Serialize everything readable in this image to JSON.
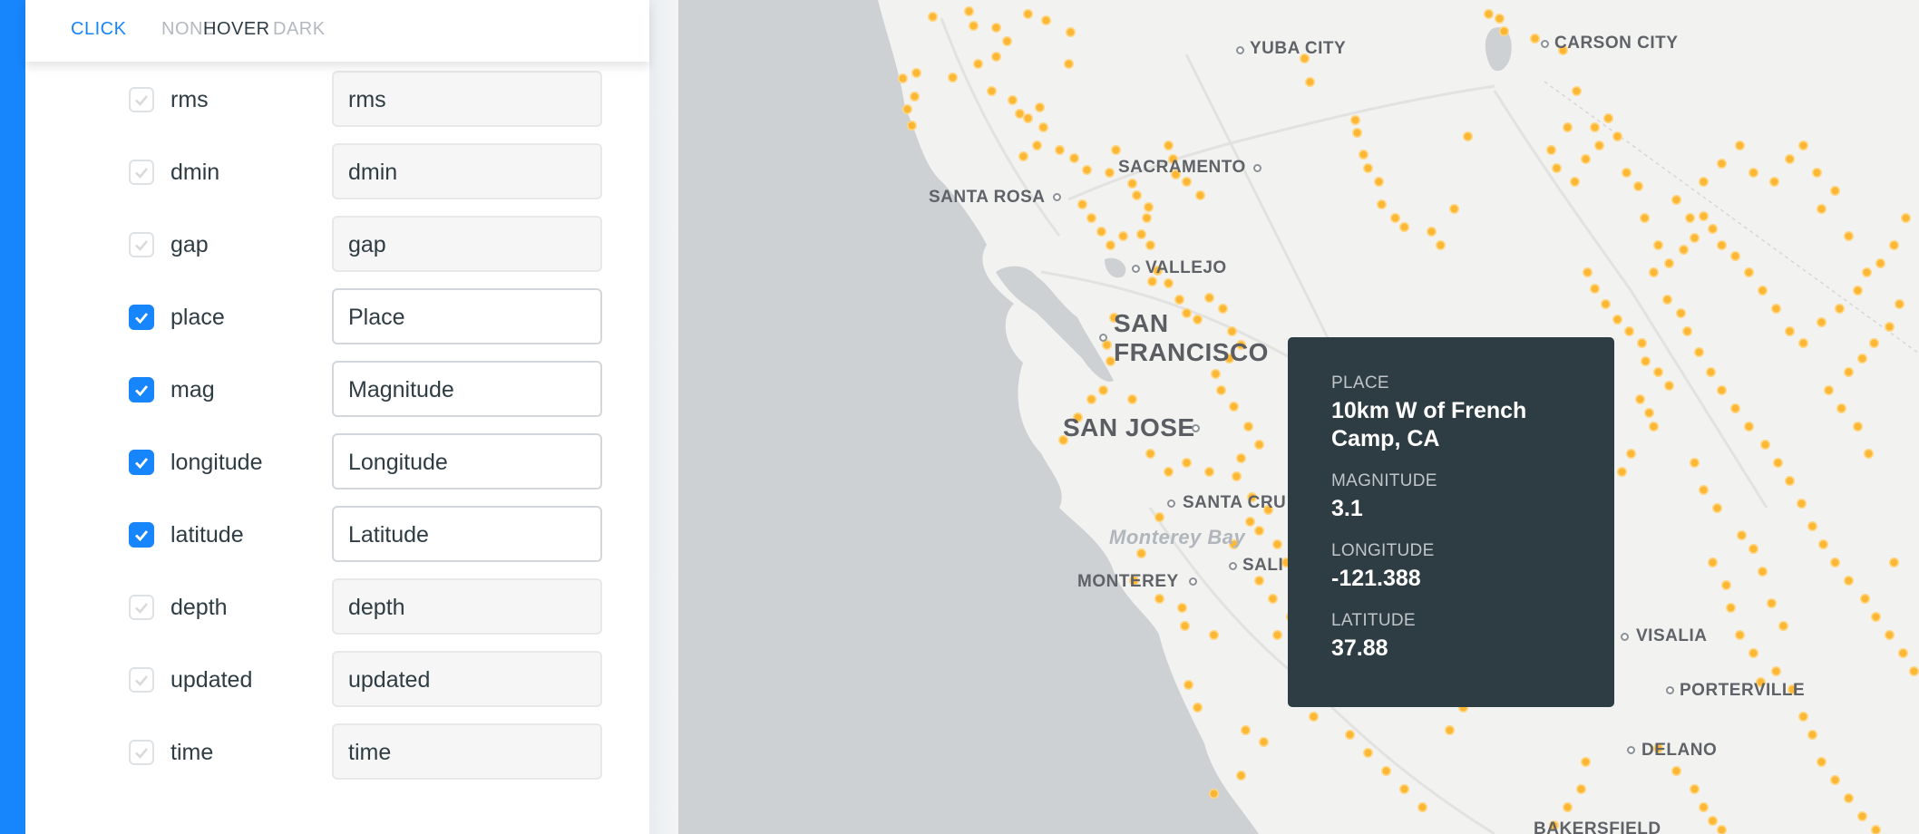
{
  "tabs": {
    "click": "CLICK",
    "none": "NONE",
    "hover": "HOVER",
    "dark": "DARK"
  },
  "fields": [
    {
      "name": "rms",
      "alias": "rms",
      "checked": false
    },
    {
      "name": "dmin",
      "alias": "dmin",
      "checked": false
    },
    {
      "name": "gap",
      "alias": "gap",
      "checked": false
    },
    {
      "name": "place",
      "alias": "Place",
      "checked": true
    },
    {
      "name": "mag",
      "alias": "Magnitude",
      "checked": true
    },
    {
      "name": "longitude",
      "alias": "Longitude",
      "checked": true
    },
    {
      "name": "latitude",
      "alias": "Latitude",
      "checked": true
    },
    {
      "name": "depth",
      "alias": "depth",
      "checked": false
    },
    {
      "name": "updated",
      "alias": "updated",
      "checked": false
    },
    {
      "name": "time",
      "alias": "time",
      "checked": false
    }
  ],
  "map": {
    "cities": {
      "yuba_city": "YUBA CITY",
      "carson_city": "CARSON CITY",
      "sacramento": "SACRAMENTO",
      "santa_rosa": "SANTA ROSA",
      "vallejo": "VALLEJO",
      "san": "SAN",
      "francisco": "FRANCISCO",
      "san_jose": "SAN JOSE",
      "santa_cruz": "SANTA CRU",
      "monterey_bay": "Monterey Bay",
      "monterey": "MONTEREY",
      "salinas": "SALI",
      "visalia": "VISALIA",
      "porterville": "PORTERVILLE",
      "delano": "DELANO",
      "bakersfield": "BAKERSFIELD"
    },
    "colors": {
      "ocean": "#cdd1d4",
      "land": "#f2f2f0",
      "quake": "#fdb42a",
      "tooltip": "#2e3c43",
      "accent": "#1785fb"
    }
  },
  "tooltip": {
    "place_key": "PLACE",
    "place_value": "10km W of French Camp, CA",
    "mag_key": "MAGNITUDE",
    "mag_value": "3.1",
    "lon_key": "LONGITUDE",
    "lon_value": "-121.388",
    "lat_key": "LATITUDE",
    "lat_value": "37.88"
  }
}
